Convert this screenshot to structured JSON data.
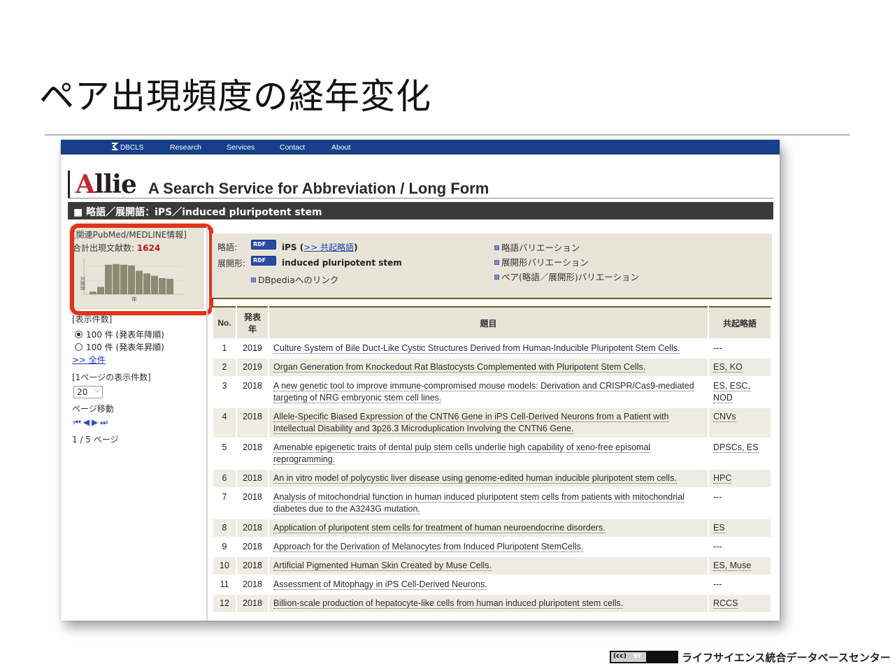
{
  "slide": {
    "title": "ペア出現頻度の経年変化"
  },
  "navbar": {
    "logo": "DBCLS",
    "items": [
      "Research",
      "Services",
      "Contact",
      "About"
    ]
  },
  "brand": {
    "logo_first": "A",
    "logo_rest": "llie",
    "tagline": "A Search Service for Abbreviation / Long Form"
  },
  "section": {
    "heading": "■ 略語／展開語：iPS／induced pluripotent stem"
  },
  "left_panel": {
    "related_link": "[関連PubMed/MEDLINE情報]",
    "total_label": "合計出現文献数:",
    "total_value": "1624",
    "hist_ylabel": "文献数",
    "hist_xlabel": "年",
    "display_count_label": "[表示件数]",
    "radio_desc": "100 件 (発表年降順)",
    "radio_asc": "100 件 (発表年昇順)",
    "all_link": ">> 全件",
    "per_page_label": "[1ページの表示件数]",
    "per_page_value": "20",
    "page_move_label": "ページ移動",
    "page_status": "1 / 5 ページ"
  },
  "detail": {
    "abbr_label": "略語:",
    "abbr_value": "iPS",
    "cooccur_link": ">> 共起略語",
    "long_label": "展開形:",
    "long_value": "induced pluripotent stem",
    "rdf_badge": "RDF",
    "dbpedia_link": "DBpediaへのリンク",
    "variation_links": [
      "略語バリエーション",
      "展開形バリエーション",
      "ペア(略語／展開形)バリエーション"
    ]
  },
  "table": {
    "headers": [
      "No.",
      "発表年",
      "題目",
      "共起略語"
    ],
    "rows": [
      {
        "no": "1",
        "year": "2019",
        "title": "Culture System of Bile Duct-Like Cystic Structures Derived from Human-Inducible Pluripotent Stem Cells.",
        "co": "---"
      },
      {
        "no": "2",
        "year": "2019",
        "title": "Organ Generation from Knockedout Rat Blastocysts Complemented with Pluripotent Stem Cells.",
        "co": "ES, KO"
      },
      {
        "no": "3",
        "year": "2018",
        "title": "A new genetic tool to improve immune-compromised mouse models: Derivation and CRISPR/Cas9-mediated targeting of NRG embryonic stem cell lines.",
        "co": "ES, ESC, NOD"
      },
      {
        "no": "4",
        "year": "2018",
        "title": "Allele-Specific Biased Expression of the CNTN6 Gene in iPS Cell-Derived Neurons from a Patient with Intellectual Disability and 3p26.3 Microduplication Involving the CNTN6 Gene.",
        "co": "CNVs"
      },
      {
        "no": "5",
        "year": "2018",
        "title": "Amenable epigenetic traits of dental pulp stem cells underlie high capability of xeno-free episomal reprogramming.",
        "co": "DPSCs, ES"
      },
      {
        "no": "6",
        "year": "2018",
        "title": "An in vitro model of polycystic liver disease using genome-edited human inducible pluripotent stem cells.",
        "co": "HPC"
      },
      {
        "no": "7",
        "year": "2018",
        "title": "Analysis of mitochondrial function in human induced pluripotent stem cells from patients with mitochondrial diabetes due to the A3243G mutation.",
        "co": "---"
      },
      {
        "no": "8",
        "year": "2018",
        "title": "Application of pluripotent stem cells for treatment of human neuroendocrine disorders.",
        "co": "ES"
      },
      {
        "no": "9",
        "year": "2018",
        "title": "Approach for the Derivation of Melanocytes from Induced Pluripotent StemCells.",
        "co": "---"
      },
      {
        "no": "10",
        "year": "2018",
        "title": "Artificial Pigmented Human Skin Created by Muse Cells.",
        "co": "ES, Muse"
      },
      {
        "no": "11",
        "year": "2018",
        "title": "Assessment of Mitophagy in iPS Cell-Derived Neurons.",
        "co": "---"
      },
      {
        "no": "12",
        "year": "2018",
        "title": "Billion-scale production of hepatocyte-like cells from human induced pluripotent stem cells.",
        "co": "RCCS"
      }
    ]
  },
  "mini_histogram": {
    "relative_levels": [
      0.08,
      0.22,
      0.88,
      0.9,
      0.88,
      0.86,
      0.7,
      0.62,
      0.55,
      0.48,
      0.46
    ]
  },
  "footer": {
    "license_badge": "(cc)",
    "license_by": "BY",
    "org": "ライフサイエンス統合データベースセンター"
  },
  "colors": {
    "navbar": "#183f8a",
    "section_bar": "#3a3a3a",
    "highlight": "#e0331a",
    "panel_bg": "#e8e5d8",
    "total_value": "#c4161c"
  }
}
